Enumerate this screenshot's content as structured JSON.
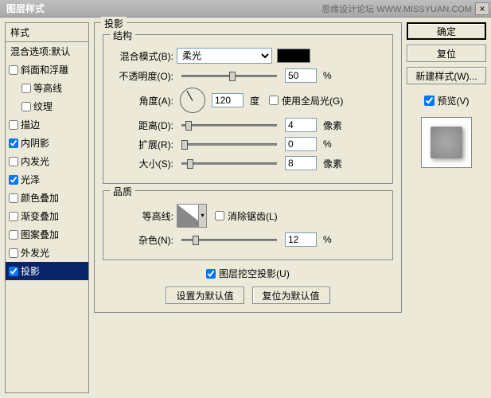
{
  "window": {
    "title": "图层样式",
    "watermark": "思缘设计论坛 WWW.MISSYUAN.COM",
    "close": "×"
  },
  "sidebar": {
    "header": "样式",
    "blend_options": "混合选项:默认",
    "items": [
      {
        "label": "斜面和浮雕",
        "checked": false,
        "indent": false
      },
      {
        "label": "等高线",
        "checked": false,
        "indent": true
      },
      {
        "label": "纹理",
        "checked": false,
        "indent": true
      },
      {
        "label": "描边",
        "checked": false,
        "indent": false
      },
      {
        "label": "内阴影",
        "checked": true,
        "indent": false
      },
      {
        "label": "内发光",
        "checked": false,
        "indent": false
      },
      {
        "label": "光泽",
        "checked": true,
        "indent": false
      },
      {
        "label": "颜色叠加",
        "checked": false,
        "indent": false
      },
      {
        "label": "渐变叠加",
        "checked": false,
        "indent": false
      },
      {
        "label": "图案叠加",
        "checked": false,
        "indent": false
      },
      {
        "label": "外发光",
        "checked": false,
        "indent": false
      },
      {
        "label": "投影",
        "checked": true,
        "indent": false,
        "selected": true
      }
    ]
  },
  "panel": {
    "title": "投影",
    "structure_title": "结构",
    "blend_mode_label": "混合模式(B):",
    "blend_mode_value": "柔光",
    "opacity_label": "不透明度(O):",
    "opacity_value": "50",
    "opacity_unit": "%",
    "angle_label": "角度(A):",
    "angle_value": "120",
    "angle_unit": "度",
    "global_light_label": "使用全局光(G)",
    "global_light_checked": false,
    "distance_label": "距离(D):",
    "distance_value": "4",
    "distance_unit": "像素",
    "spread_label": "扩展(R):",
    "spread_value": "0",
    "spread_unit": "%",
    "size_label": "大小(S):",
    "size_value": "8",
    "size_unit": "像素",
    "quality_title": "品质",
    "contour_label": "等高线:",
    "antialias_label": "消除锯齿(L)",
    "antialias_checked": false,
    "noise_label": "杂色(N):",
    "noise_value": "12",
    "noise_unit": "%",
    "knockout_label": "图层挖空投影(U)",
    "knockout_checked": true,
    "set_default": "设置为默认值",
    "reset_default": "复位为默认值"
  },
  "right": {
    "ok": "确定",
    "cancel": "复位",
    "new_style": "新建样式(W)...",
    "preview_label": "预览(V)",
    "preview_checked": true
  }
}
